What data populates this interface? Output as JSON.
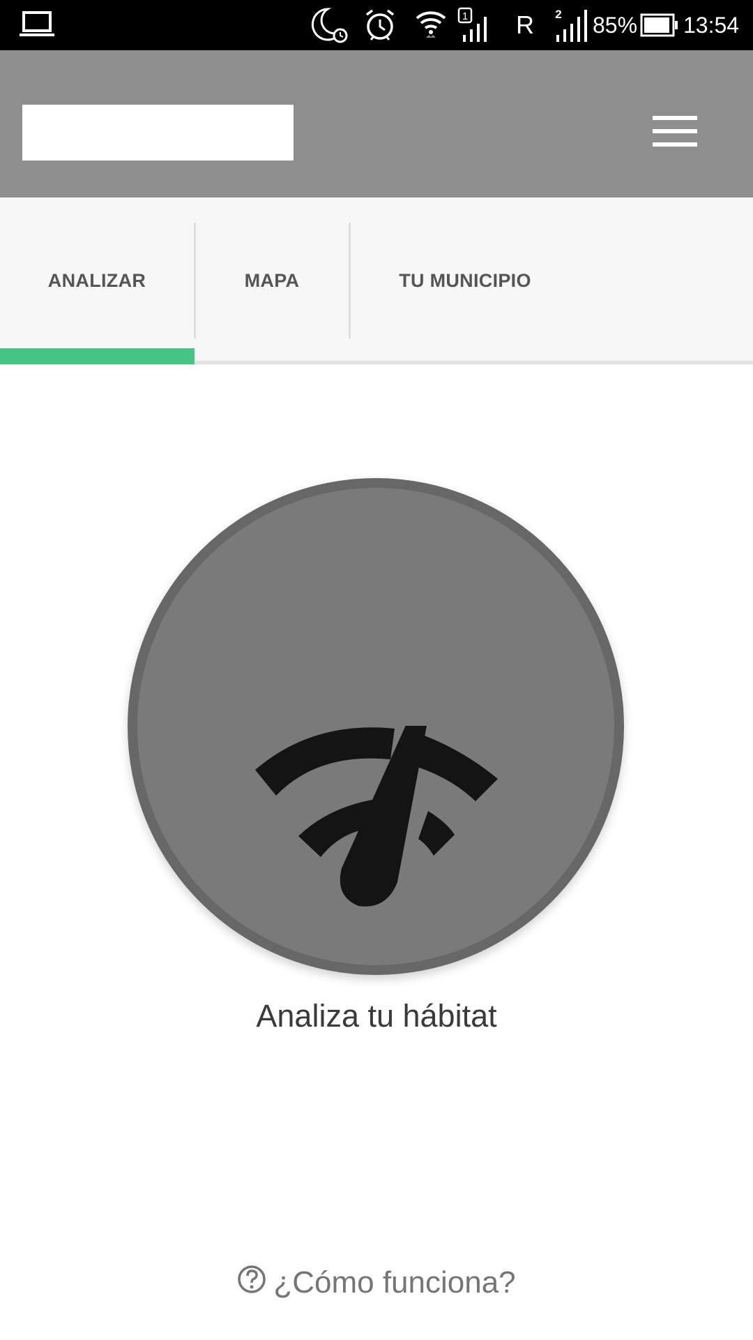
{
  "status_bar": {
    "roaming": "R",
    "sim1_label": "1",
    "sim2_label": "2",
    "battery_percent": "85%",
    "time": "13:54",
    "icons": [
      "laptop-icon",
      "night-mode-icon",
      "alarm-icon",
      "wifi-icon",
      "signal-icon",
      "battery-icon"
    ]
  },
  "header": {
    "menu_icon": "hamburger-icon"
  },
  "tabs": [
    {
      "label": "ANALIZAR",
      "active": true
    },
    {
      "label": "MAPA",
      "active": false
    },
    {
      "label": "TU MUNICIPIO",
      "active": false
    }
  ],
  "main": {
    "action_icon": "speedometer-icon",
    "action_label": "Analiza tu hábitat",
    "help_label": "¿Cómo funciona?",
    "help_icon": "question-circle-icon"
  },
  "colors": {
    "header_bg": "#8e8e8e",
    "tab_indicator": "#45c484",
    "circle_bg": "#7a7a7a",
    "circle_ring": "#676767"
  }
}
